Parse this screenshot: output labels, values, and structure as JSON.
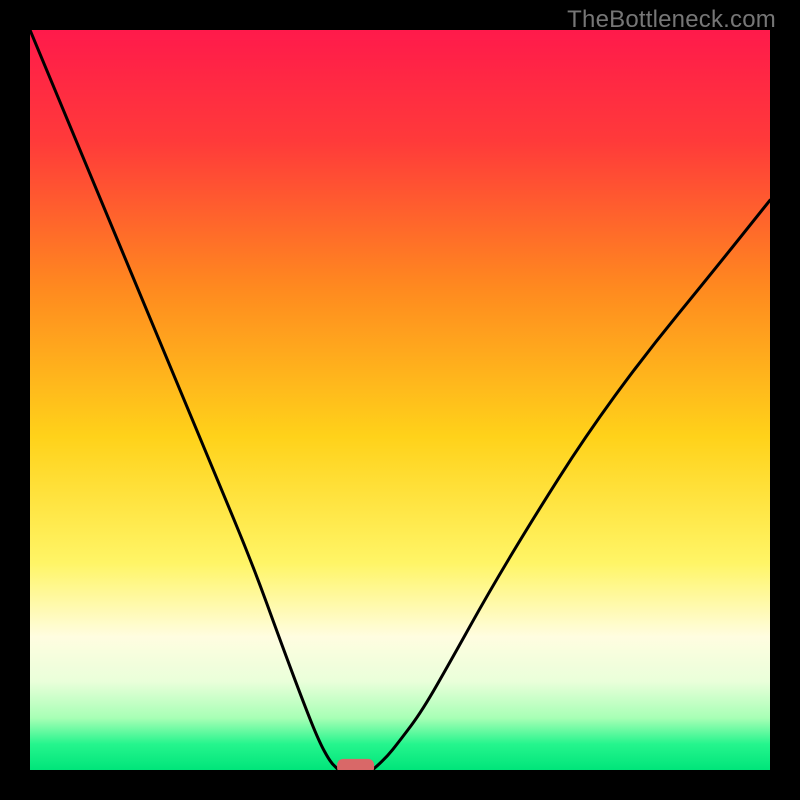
{
  "attribution": "TheBottleneck.com",
  "chart_data": {
    "type": "line",
    "title": "",
    "xlabel": "",
    "ylabel": "",
    "xlim": [
      0,
      100
    ],
    "ylim": [
      0,
      100
    ],
    "gradient_stops": [
      {
        "offset": 0.0,
        "color": "#ff1a4b"
      },
      {
        "offset": 0.15,
        "color": "#ff3a3a"
      },
      {
        "offset": 0.35,
        "color": "#ff8a1f"
      },
      {
        "offset": 0.55,
        "color": "#ffd21a"
      },
      {
        "offset": 0.72,
        "color": "#fff566"
      },
      {
        "offset": 0.82,
        "color": "#fffde0"
      },
      {
        "offset": 0.88,
        "color": "#eaffda"
      },
      {
        "offset": 0.93,
        "color": "#a7ffb5"
      },
      {
        "offset": 0.965,
        "color": "#25f58d"
      },
      {
        "offset": 1.0,
        "color": "#00e57a"
      }
    ],
    "series": [
      {
        "name": "left-curve",
        "x": [
          0,
          5,
          10,
          15,
          20,
          25,
          30,
          34,
          37,
          39,
          40.5,
          41.5
        ],
        "values": [
          100,
          88,
          76,
          64,
          52,
          40,
          28,
          17,
          9,
          4,
          1.2,
          0.2
        ]
      },
      {
        "name": "right-curve",
        "x": [
          46.5,
          48,
          50,
          53,
          57,
          62,
          68,
          75,
          83,
          92,
          100
        ],
        "values": [
          0.2,
          1.5,
          4,
          8,
          15,
          24,
          34,
          45,
          56,
          67,
          77
        ]
      }
    ],
    "marker": {
      "name": "bottom-marker",
      "x_center": 44,
      "y": 0.5,
      "width": 5,
      "height": 2,
      "color": "#d96868"
    }
  }
}
